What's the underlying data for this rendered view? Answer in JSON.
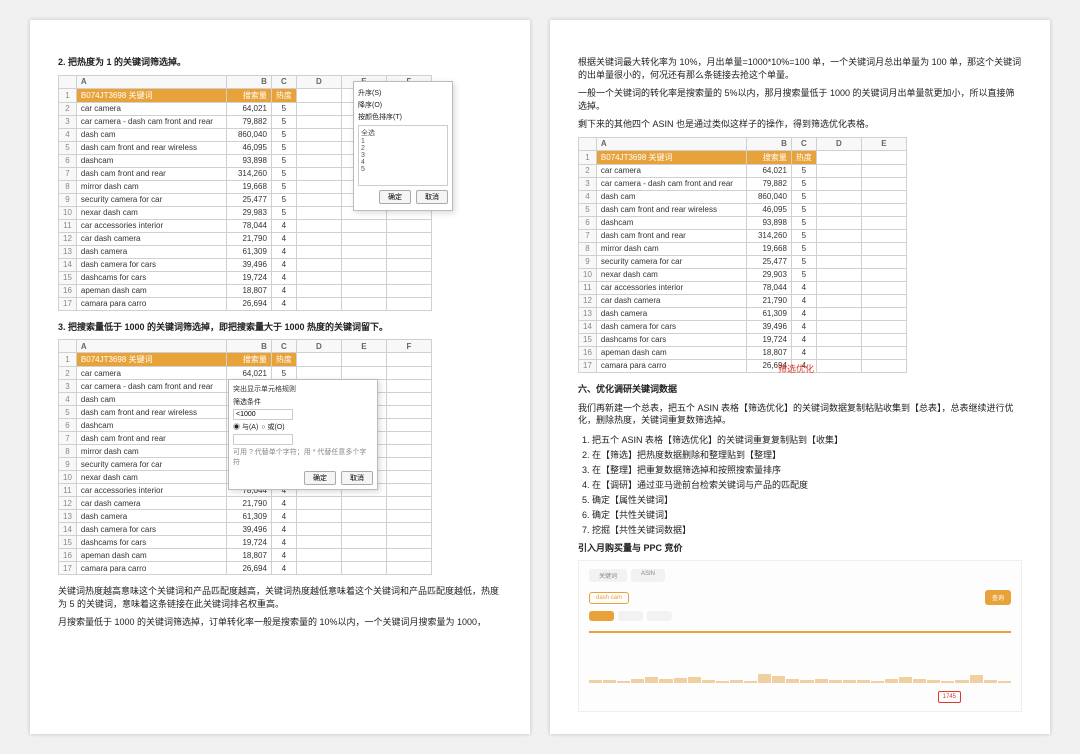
{
  "left": {
    "heading2": "2. 把热度为 1 的关键词筛选掉。",
    "heading3": "3. 把搜索量低于 1000 的关键词筛选掉，即把搜索量大于 1000 热度的关键词留下。",
    "table_header": {
      "asin_label": "B074JT3698 关键词",
      "col_search": "搜索量",
      "col_heat": "热度"
    },
    "columns": [
      "A",
      "B",
      "C",
      "D",
      "E",
      "F"
    ],
    "rows": [
      {
        "n": 2,
        "kw": "car camera",
        "search": "64,021",
        "heat": "5"
      },
      {
        "n": 3,
        "kw": "car camera - dash cam front and rear",
        "search": "79,882",
        "heat": "5"
      },
      {
        "n": 4,
        "kw": "dash cam",
        "search": "860,040",
        "heat": "5"
      },
      {
        "n": 5,
        "kw": "dash cam front and rear wireless",
        "search": "46,095",
        "heat": "5"
      },
      {
        "n": 6,
        "kw": "dashcam",
        "search": "93,898",
        "heat": "5"
      },
      {
        "n": 7,
        "kw": "dash cam front and rear",
        "search": "314,260",
        "heat": "5"
      },
      {
        "n": 8,
        "kw": "mirror dash cam",
        "search": "19,668",
        "heat": "5"
      },
      {
        "n": 9,
        "kw": "security camera for car",
        "search": "25,477",
        "heat": "5"
      },
      {
        "n": 10,
        "kw": "nexar dash cam",
        "search": "29,983",
        "heat": "5"
      },
      {
        "n": 11,
        "kw": "car accessories interior",
        "search": "78,044",
        "heat": "4"
      },
      {
        "n": 12,
        "kw": "car dash camera",
        "search": "21,790",
        "heat": "4"
      },
      {
        "n": 13,
        "kw": "dash camera",
        "search": "61,309",
        "heat": "4"
      },
      {
        "n": 14,
        "kw": "dash camera for cars",
        "search": "39,496",
        "heat": "4"
      },
      {
        "n": 15,
        "kw": "dashcams for cars",
        "search": "19,724",
        "heat": "4"
      },
      {
        "n": 16,
        "kw": "apeman dash cam",
        "search": "18,807",
        "heat": "4"
      },
      {
        "n": 17,
        "kw": "camara para carro",
        "search": "26,694",
        "heat": "4"
      }
    ],
    "filter_dialog": {
      "menu1": "升序(S)",
      "menu2": "降序(O)",
      "menu3": "按颜色排序(T)",
      "ok": "确定",
      "cancel": "取消",
      "item_all": "全选",
      "items": [
        "1",
        "2",
        "3",
        "4",
        "5"
      ]
    },
    "condfmt_dialog": {
      "title": "突出显示单元格规则",
      "label": "筛选条件",
      "value": "<1000",
      "radio1": "与(A)",
      "radio2": "或(O)",
      "hint": "可用 ? 代替单个字符；用 * 代替任意多个字符",
      "ok": "确定",
      "cancel": "取消"
    },
    "bottom_para1": "关键词热度越高意味这个关键词和产品匹配度越高，关键词热度越低意味着这个关键词和产品匹配度越低，热度为 5 的关键词，意味着这条链接在此关键词排名权重高。",
    "bottom_para2": "月搜索量低于 1000 的关键词筛选掉，订单转化率一般是搜索量的 10%以内，一个关键词月搜索量为 1000，"
  },
  "right": {
    "top_para1": "根据关键词最大转化率为 10%，月出单量=1000*10%=100 单，一个关键词月总出单量为 100 单，那这个关键词的出单量很小的，何况还有那么条链接去抢这个单量。",
    "top_para2": "一般一个关键词的转化率是搜索量的 5%以内，那月搜索量低于 1000 的关键词月出单量就更加小，所以直接筛选掉。",
    "top_para3": "剩下来的其他四个 ASIN 也是通过类似这样子的操作，得到筛选优化表格。",
    "columns": [
      "A",
      "B",
      "C",
      "D",
      "E"
    ],
    "rows": [
      {
        "n": 2,
        "kw": "car camera",
        "search": "64,021",
        "heat": "5"
      },
      {
        "n": 3,
        "kw": "car camera - dash cam front and rear",
        "search": "79,882",
        "heat": "5"
      },
      {
        "n": 4,
        "kw": "dash cam",
        "search": "860,040",
        "heat": "5"
      },
      {
        "n": 5,
        "kw": "dash cam front and rear wireless",
        "search": "46,095",
        "heat": "5"
      },
      {
        "n": 6,
        "kw": "dashcam",
        "search": "93,898",
        "heat": "5"
      },
      {
        "n": 7,
        "kw": "dash cam front and rear",
        "search": "314,260",
        "heat": "5"
      },
      {
        "n": 8,
        "kw": "mirror dash cam",
        "search": "19,668",
        "heat": "5"
      },
      {
        "n": 9,
        "kw": "security camera for car",
        "search": "25,477",
        "heat": "5"
      },
      {
        "n": 10,
        "kw": "nexar dash cam",
        "search": "29,903",
        "heat": "5"
      },
      {
        "n": 11,
        "kw": "car accessories interior",
        "search": "78,044",
        "heat": "4"
      },
      {
        "n": 12,
        "kw": "car dash camera",
        "search": "21,790",
        "heat": "4"
      },
      {
        "n": 13,
        "kw": "dash camera",
        "search": "61,309",
        "heat": "4"
      },
      {
        "n": 14,
        "kw": "dash camera for cars",
        "search": "39,496",
        "heat": "4"
      },
      {
        "n": 15,
        "kw": "dashcams for cars",
        "search": "19,724",
        "heat": "4"
      },
      {
        "n": 16,
        "kw": "apeman dash cam",
        "search": "18,807",
        "heat": "4"
      },
      {
        "n": 17,
        "kw": "camara para carro",
        "search": "26,694",
        "heat": "4"
      }
    ],
    "sheet_tab": "筛选优化",
    "section_h": "六、优化调研关键词数据",
    "section_intro": "我们再新建一个总表，把五个 ASIN 表格【筛选优化】的关键词数据复制粘贴收集到【总表】，总表继续进行优化，删除热度，关键词重复数筛选掉。",
    "steps": [
      "把五个 ASIN 表格【筛选优化】的关键词重复复制贴到【收集】",
      "在【筛选】把热度数据删除和整理贴到【整理】",
      "在【整理】把重复数据筛选掉和按照搜索量排序",
      "在【调研】通过亚马逊前台检索关键词与产品的匹配度",
      "确定【属性关键词】",
      "确定【共性关键词】",
      "挖掘【共性关键词数据】"
    ],
    "sub_h": "引入月购买量与 PPC 竞价",
    "dashboard": {
      "tab1": "关键词",
      "tab2": "ASIN",
      "search_hint": "dash cam",
      "btn_search": "查询",
      "marker": "1745"
    }
  },
  "table_header": {
    "asin_label": "B074JT3698 关键词",
    "col_search": "搜索量",
    "col_heat": "热度"
  }
}
